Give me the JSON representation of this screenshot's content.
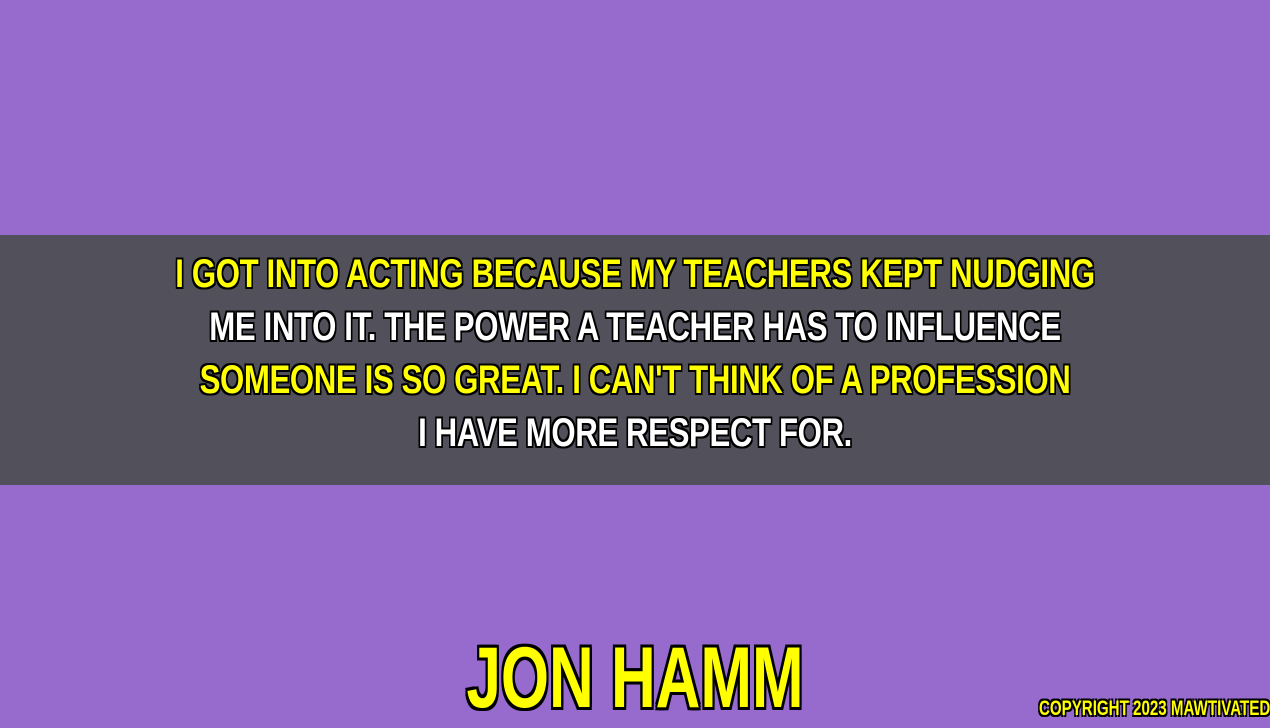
{
  "background_color": "#966bcd",
  "band_color": "#52505a",
  "accent_color": "#ffff00",
  "quote": {
    "lines": [
      "I GOT INTO ACTING BECAUSE MY TEACHERS KEPT NUDGING",
      "ME INTO IT. THE POWER A TEACHER HAS TO INFLUENCE",
      "SOMEONE IS SO GREAT. I CAN'T THINK OF A PROFESSION",
      "I HAVE MORE RESPECT FOR."
    ]
  },
  "author": "JON HAMM",
  "copyright": "COPYRIGHT 2023 MAWTIVATED"
}
